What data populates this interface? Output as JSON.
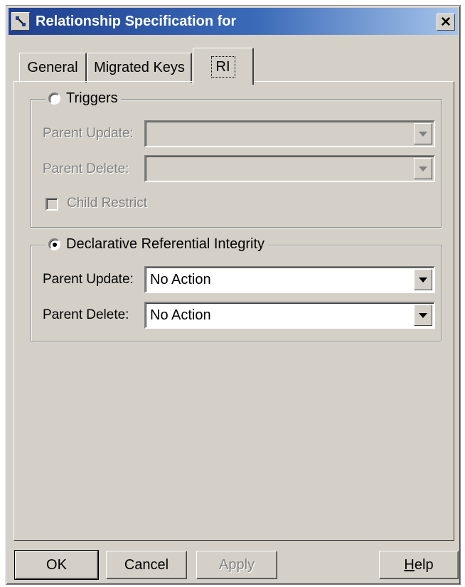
{
  "window": {
    "title": "Relationship Specification for",
    "close_symbol": "✕"
  },
  "tabs": [
    {
      "label": "General",
      "active": false
    },
    {
      "label": "Migrated Keys",
      "active": false
    },
    {
      "label": "RI",
      "active": true
    }
  ],
  "triggers_group": {
    "label": "Triggers",
    "selected": false,
    "parent_update_label": "Parent Update:",
    "parent_update_value": "",
    "parent_delete_label": "Parent Delete:",
    "parent_delete_value": "",
    "child_restrict_label": "Child Restrict",
    "child_restrict_checked": false
  },
  "dri_group": {
    "label": "Declarative Referential Integrity",
    "selected": true,
    "parent_update_label": "Parent Update:",
    "parent_update_value": "No Action",
    "parent_delete_label": "Parent Delete:",
    "parent_delete_value": "No Action"
  },
  "buttons": {
    "ok": "OK",
    "cancel": "Cancel",
    "apply": "Apply",
    "help_rest": "elp",
    "help_mnemonic": "H"
  },
  "colors": {
    "face": "#d4d0c8",
    "title_start": "#1e3f8f",
    "title_end": "#a6c4ea",
    "disabled_text": "#808080"
  }
}
